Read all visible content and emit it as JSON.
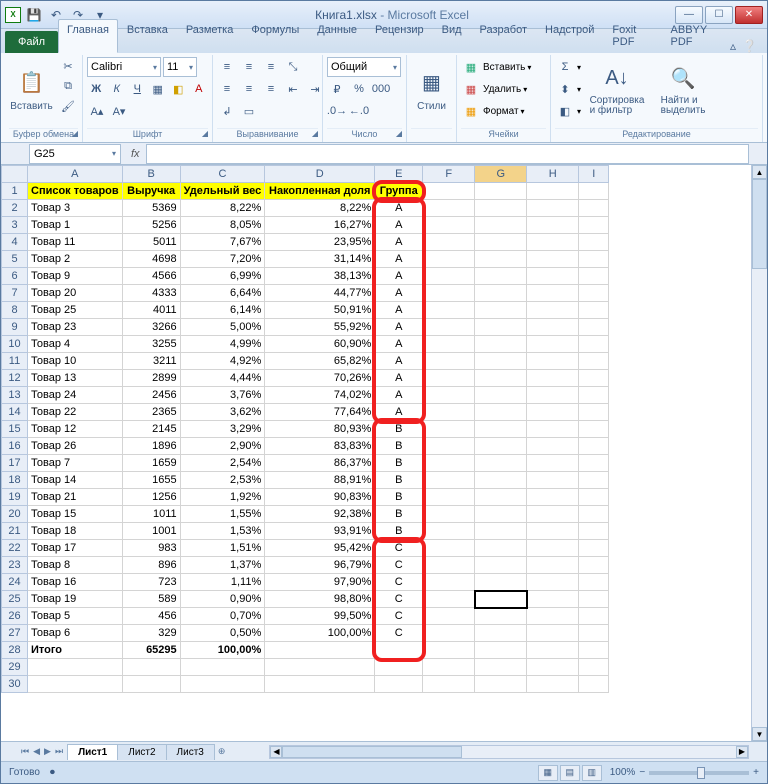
{
  "title": {
    "doc": "Книга1.xlsx",
    "app": "Microsoft Excel"
  },
  "qat_icons": [
    "save-icon",
    "undo-icon",
    "redo-icon",
    "dropdown-icon"
  ],
  "tabs": {
    "file": "Файл",
    "items": [
      "Главная",
      "Вставка",
      "Разметка",
      "Формулы",
      "Данные",
      "Рецензир",
      "Вид",
      "Разработ",
      "Надстрой",
      "Foxit PDF",
      "ABBYY PDF"
    ],
    "active": 0
  },
  "ribbon": {
    "clipboard": {
      "paste": "Вставить",
      "label": "Буфер обмена"
    },
    "font": {
      "name": "Calibri",
      "size": "11",
      "label": "Шрифт"
    },
    "align": {
      "label": "Выравнивание"
    },
    "number": {
      "format": "Общий",
      "label": "Число"
    },
    "styles": {
      "btn": "Стили",
      "label": ""
    },
    "cells": {
      "insert": "Вставить",
      "delete": "Удалить",
      "format": "Формат",
      "label": "Ячейки"
    },
    "editing": {
      "sort": "Сортировка\nи фильтр",
      "find": "Найти и\nвыделить",
      "label": "Редактирование"
    }
  },
  "namebox": "G25",
  "columns": [
    "A",
    "B",
    "C",
    "D",
    "E",
    "F",
    "G",
    "H",
    "I"
  ],
  "headers": {
    "A": "Список товаров",
    "B": "Выручка",
    "C": "Удельный вес",
    "D": "Накопленная доля",
    "E": "Группа"
  },
  "rows": [
    {
      "n": 2,
      "a": "Товар 3",
      "b": "5369",
      "c": "8,22%",
      "d": "8,22%",
      "e": "A"
    },
    {
      "n": 3,
      "a": "Товар 1",
      "b": "5256",
      "c": "8,05%",
      "d": "16,27%",
      "e": "A"
    },
    {
      "n": 4,
      "a": "Товар 11",
      "b": "5011",
      "c": "7,67%",
      "d": "23,95%",
      "e": "A"
    },
    {
      "n": 5,
      "a": "Товар 2",
      "b": "4698",
      "c": "7,20%",
      "d": "31,14%",
      "e": "A"
    },
    {
      "n": 6,
      "a": "Товар 9",
      "b": "4566",
      "c": "6,99%",
      "d": "38,13%",
      "e": "A"
    },
    {
      "n": 7,
      "a": "Товар 20",
      "b": "4333",
      "c": "6,64%",
      "d": "44,77%",
      "e": "A"
    },
    {
      "n": 8,
      "a": "Товар 25",
      "b": "4011",
      "c": "6,14%",
      "d": "50,91%",
      "e": "A"
    },
    {
      "n": 9,
      "a": "Товар 23",
      "b": "3266",
      "c": "5,00%",
      "d": "55,92%",
      "e": "A"
    },
    {
      "n": 10,
      "a": "Товар 4",
      "b": "3255",
      "c": "4,99%",
      "d": "60,90%",
      "e": "A"
    },
    {
      "n": 11,
      "a": "Товар 10",
      "b": "3211",
      "c": "4,92%",
      "d": "65,82%",
      "e": "A"
    },
    {
      "n": 12,
      "a": "Товар 13",
      "b": "2899",
      "c": "4,44%",
      "d": "70,26%",
      "e": "A"
    },
    {
      "n": 13,
      "a": "Товар 24",
      "b": "2456",
      "c": "3,76%",
      "d": "74,02%",
      "e": "A"
    },
    {
      "n": 14,
      "a": "Товар 22",
      "b": "2365",
      "c": "3,62%",
      "d": "77,64%",
      "e": "A"
    },
    {
      "n": 15,
      "a": "Товар 12",
      "b": "2145",
      "c": "3,29%",
      "d": "80,93%",
      "e": "B"
    },
    {
      "n": 16,
      "a": "Товар 26",
      "b": "1896",
      "c": "2,90%",
      "d": "83,83%",
      "e": "B"
    },
    {
      "n": 17,
      "a": "Товар 7",
      "b": "1659",
      "c": "2,54%",
      "d": "86,37%",
      "e": "B"
    },
    {
      "n": 18,
      "a": "Товар 14",
      "b": "1655",
      "c": "2,53%",
      "d": "88,91%",
      "e": "B"
    },
    {
      "n": 19,
      "a": "Товар 21",
      "b": "1256",
      "c": "1,92%",
      "d": "90,83%",
      "e": "B"
    },
    {
      "n": 20,
      "a": "Товар 15",
      "b": "1011",
      "c": "1,55%",
      "d": "92,38%",
      "e": "B"
    },
    {
      "n": 21,
      "a": "Товар 18",
      "b": "1001",
      "c": "1,53%",
      "d": "93,91%",
      "e": "B"
    },
    {
      "n": 22,
      "a": "Товар 17",
      "b": "983",
      "c": "1,51%",
      "d": "95,42%",
      "e": "C"
    },
    {
      "n": 23,
      "a": "Товар 8",
      "b": "896",
      "c": "1,37%",
      "d": "96,79%",
      "e": "C"
    },
    {
      "n": 24,
      "a": "Товар 16",
      "b": "723",
      "c": "1,11%",
      "d": "97,90%",
      "e": "C"
    },
    {
      "n": 25,
      "a": "Товар 19",
      "b": "589",
      "c": "0,90%",
      "d": "98,80%",
      "e": "C"
    },
    {
      "n": 26,
      "a": "Товар 5",
      "b": "456",
      "c": "0,70%",
      "d": "99,50%",
      "e": "C"
    },
    {
      "n": 27,
      "a": "Товар 6",
      "b": "329",
      "c": "0,50%",
      "d": "100,00%",
      "e": "C"
    }
  ],
  "total": {
    "n": 28,
    "a": "Итого",
    "b": "65295",
    "c": "100,00%"
  },
  "blank_rows": [
    29,
    30
  ],
  "selected_cell": {
    "col": "G",
    "row": 25
  },
  "sheets": {
    "items": [
      "Лист1",
      "Лист2",
      "Лист3"
    ],
    "active": 0
  },
  "status": {
    "ready": "Готово",
    "zoom": "100%"
  }
}
